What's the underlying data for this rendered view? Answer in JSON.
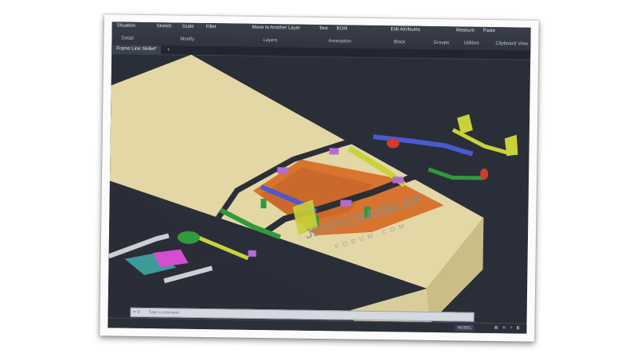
{
  "ribbon": {
    "commands": {
      "smallcut": "Situation",
      "stretch": "Stretch",
      "scale": "Scale",
      "fillet": "Fillet",
      "move_layer": "Move to Another Layer",
      "text": "Text",
      "bom": "BOM",
      "edit_attributes": "Edit Attributes",
      "paste": "Paste",
      "measure": "Measure"
    },
    "groups": {
      "detail": "Detail",
      "modify": "Modify",
      "layers": "Layers",
      "annotation": "Annotation",
      "block": "Block",
      "groups": "Groups",
      "utilities": "Utilities",
      "clipboard": "Clipboard",
      "view": "View"
    }
  },
  "document_tab": {
    "label": "Frame Line Skillet*",
    "add": "+"
  },
  "command_line": {
    "placeholder": "Type a command",
    "icons": "✕ ⚲"
  },
  "status": {
    "model": "MODEL",
    "icons": "▦ ⊕ ⌖ ◧"
  },
  "watermark": {
    "main": "JEEPSCRAMBLER",
    "sub": "FORUM.COM"
  },
  "colors": {
    "viewport_bg": "#2a2e38",
    "floor_top": "#e2d7a5",
    "floor_side": "#cbbd86",
    "frame_rail": "#2b2e36",
    "floor_pan": "#d8742e",
    "crossmember_yellow": "#c8d23a",
    "crossmember_green": "#2f9a3e",
    "crossmember_blue": "#4a5ad0",
    "brackets_purple": "#b56ad8",
    "accent_red": "#d33a2a",
    "accent_magenta": "#d24fd0",
    "rail_front_grey": "#c9d0d4",
    "teal": "#3fb7b1"
  }
}
